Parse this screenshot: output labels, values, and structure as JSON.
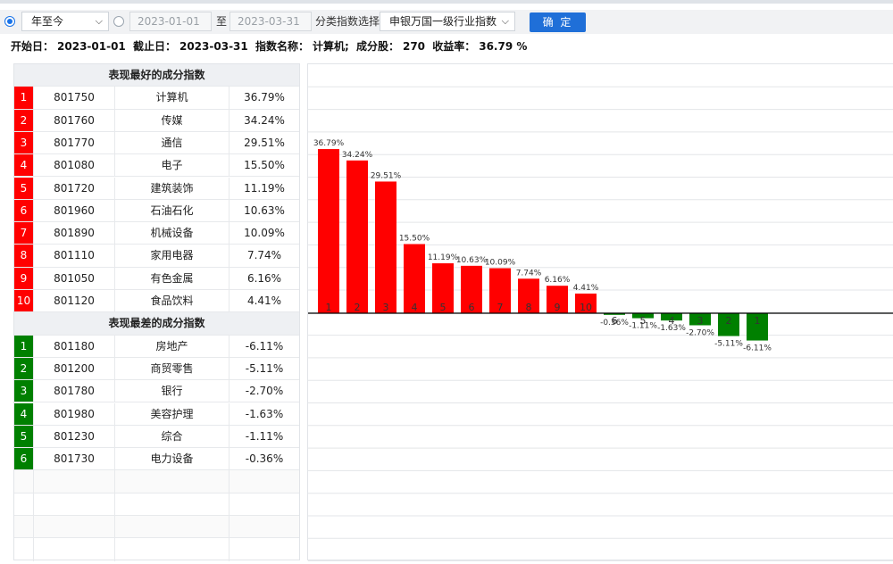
{
  "toolbar": {
    "period_select": "年至今",
    "start_date_placeholder": "2023-01-01",
    "to_label": "至",
    "end_date_placeholder": "2023-03-31",
    "category_label": "分类指数选择",
    "category_select": "申银万国一级行业指数",
    "confirm_label": "确 定"
  },
  "info": {
    "start_label": "开始日：",
    "start_value": "2023-01-01",
    "end_label": "截止日：",
    "end_value": "2023-03-31",
    "index_label": "指数名称：",
    "index_value": "计算机;",
    "count_label": "成分股：",
    "count_value": "270",
    "return_label": "收益率：",
    "return_value": "36.79 %"
  },
  "table": {
    "best_title": "表现最好的成分指数",
    "worst_title": "表现最差的成分指数",
    "best": [
      {
        "rank": "1",
        "code": "801750",
        "name": "计算机",
        "ret": "36.79%"
      },
      {
        "rank": "2",
        "code": "801760",
        "name": "传媒",
        "ret": "34.24%"
      },
      {
        "rank": "3",
        "code": "801770",
        "name": "通信",
        "ret": "29.51%"
      },
      {
        "rank": "4",
        "code": "801080",
        "name": "电子",
        "ret": "15.50%"
      },
      {
        "rank": "5",
        "code": "801720",
        "name": "建筑装饰",
        "ret": "11.19%"
      },
      {
        "rank": "6",
        "code": "801960",
        "name": "石油石化",
        "ret": "10.63%"
      },
      {
        "rank": "7",
        "code": "801890",
        "name": "机械设备",
        "ret": "10.09%"
      },
      {
        "rank": "8",
        "code": "801110",
        "name": "家用电器",
        "ret": "7.74%"
      },
      {
        "rank": "9",
        "code": "801050",
        "name": "有色金属",
        "ret": "6.16%"
      },
      {
        "rank": "10",
        "code": "801120",
        "name": "食品饮料",
        "ret": "4.41%"
      }
    ],
    "worst": [
      {
        "rank": "1",
        "code": "801180",
        "name": "房地产",
        "ret": "-6.11%"
      },
      {
        "rank": "2",
        "code": "801200",
        "name": "商贸零售",
        "ret": "-5.11%"
      },
      {
        "rank": "3",
        "code": "801780",
        "name": "银行",
        "ret": "-2.70%"
      },
      {
        "rank": "4",
        "code": "801980",
        "name": "美容护理",
        "ret": "-1.63%"
      },
      {
        "rank": "5",
        "code": "801230",
        "name": "综合",
        "ret": "-1.11%"
      },
      {
        "rank": "6",
        "code": "801730",
        "name": "电力设备",
        "ret": "-0.36%"
      }
    ]
  },
  "colors": {
    "positive": "#ff0000",
    "negative": "#008000",
    "accent": "#1f6fd8"
  },
  "chart_data": {
    "type": "bar",
    "categories": [
      "1",
      "2",
      "3",
      "4",
      "5",
      "6",
      "7",
      "8",
      "9",
      "10",
      "6",
      "5",
      "4",
      "3",
      "2",
      "1"
    ],
    "values": [
      36.79,
      34.24,
      29.51,
      15.5,
      11.19,
      10.63,
      10.09,
      7.74,
      6.16,
      4.41,
      -0.36,
      -1.11,
      -1.63,
      -2.7,
      -5.11,
      -6.11
    ],
    "labels": [
      "36.79%",
      "34.24%",
      "29.51%",
      "15.50%",
      "11.19%",
      "10.63%",
      "10.09%",
      "7.74%",
      "6.16%",
      "4.41%",
      "-0.36%",
      "-1.11%",
      "-1.63%",
      "-2.70%",
      "-5.11%",
      "-6.11%"
    ],
    "grid": true,
    "legend": "none"
  }
}
